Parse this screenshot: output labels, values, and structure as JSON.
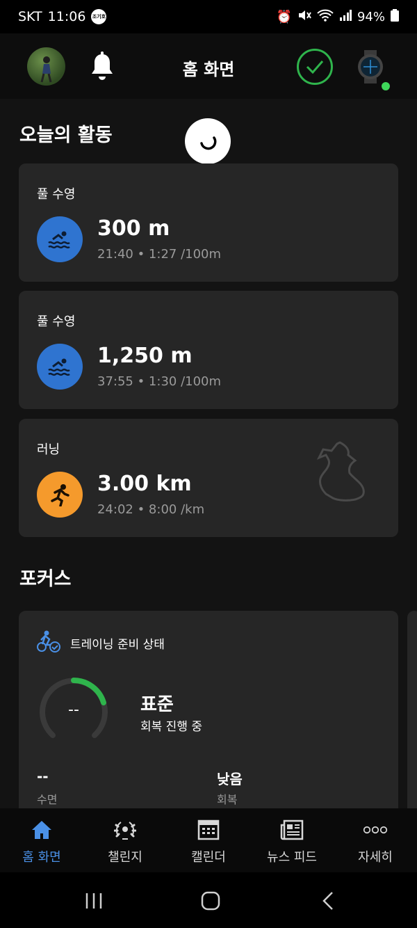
{
  "status_bar": {
    "carrier": "SKT",
    "time": "11:06",
    "badge": "조기호",
    "battery": "94%"
  },
  "header": {
    "title": "홈 화면"
  },
  "today": {
    "title": "오늘의 활동",
    "activities": [
      {
        "type": "풀 수영",
        "main": "300 m",
        "sub": "21:40 • 1:27 /100m",
        "icon": "swim-icon",
        "color": "#2f74d0"
      },
      {
        "type": "풀 수영",
        "main": "1,250 m",
        "sub": "37:55 • 1:30 /100m",
        "icon": "swim-icon",
        "color": "#2f74d0"
      },
      {
        "type": "러닝",
        "main": "3.00 km",
        "sub": "24:02 • 8:00 /km",
        "icon": "run-icon",
        "color": "#f59a2c"
      }
    ]
  },
  "focus": {
    "title": "포커스",
    "card_title": "트레이닝 준비 상태",
    "gauge_value": "--",
    "status": "표준",
    "substatus": "회복 진행 중",
    "stats": [
      {
        "value": "--",
        "label": "수면"
      },
      {
        "value": "낮음",
        "label": "회복"
      }
    ]
  },
  "bottom_nav": [
    {
      "label": "홈 화면",
      "icon": "home-icon",
      "active": true
    },
    {
      "label": "챌린지",
      "icon": "laurel-icon",
      "active": false
    },
    {
      "label": "캘린더",
      "icon": "calendar-icon",
      "active": false
    },
    {
      "label": "뉴스 피드",
      "icon": "newspaper-icon",
      "active": false
    },
    {
      "label": "자세히",
      "icon": "more-icon",
      "active": false
    }
  ],
  "colors": {
    "accent": "#4a90e6",
    "check": "#2fb44c",
    "swim": "#2f74d0",
    "run": "#f59a2c",
    "gauge": "#2fb44c"
  }
}
